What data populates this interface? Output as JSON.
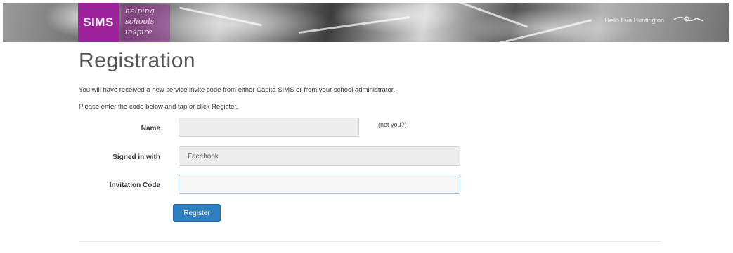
{
  "header": {
    "logo_text": "SIMS",
    "tagline": [
      "helping",
      "schools",
      "inspire"
    ],
    "greeting": "Hello Eva Huntington",
    "brand_color": "#a0239e"
  },
  "page": {
    "title": "Registration",
    "intro_line1": "You will have received a new service invite code from either Capita SIMS or from your school administrator.",
    "intro_line2": "Please enter the code below and tap or click Register."
  },
  "form": {
    "name_label": "Name",
    "name_value": "",
    "not_you_link": "(not you?)",
    "signed_in_label": "Signed in with",
    "signed_in_value": "Facebook",
    "invitation_label": "Invitation Code",
    "invitation_value": "",
    "register_label": "Register",
    "button_color": "#2f7ebf"
  },
  "icons": {
    "user_icon": "user-menu-icon"
  }
}
